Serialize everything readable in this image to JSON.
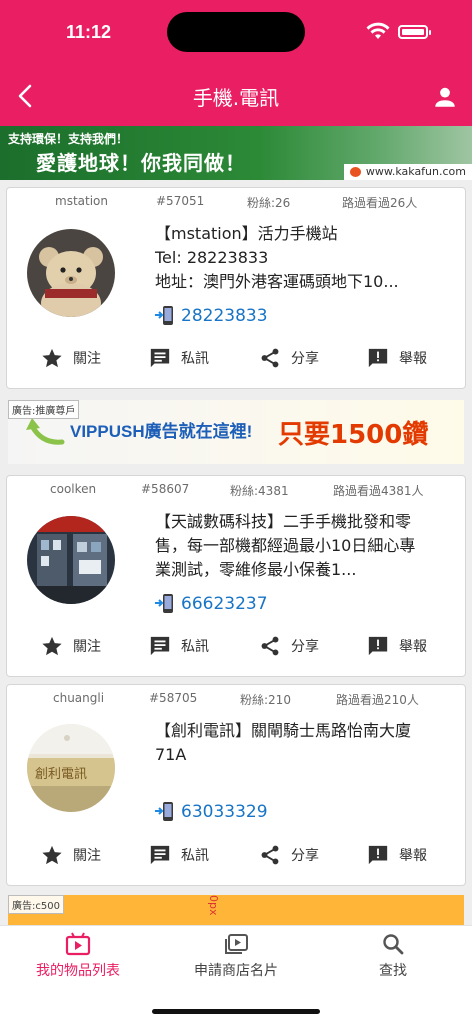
{
  "status": {
    "time": "11:12"
  },
  "header": {
    "title": "手機.電訊"
  },
  "top_banner": {
    "line1": "支持環保！支持我們！",
    "line2": "愛護地球！你我同做！",
    "site": "www.kakafun.com"
  },
  "actions": {
    "follow": "關注",
    "message": "私訊",
    "share": "分享",
    "report": "舉報"
  },
  "cards": [
    {
      "user": "mstation",
      "id": "#57051",
      "fans": "粉絲:26",
      "views": "路過看過26人",
      "lines": [
        "【mstation】活力手機站",
        "Tel: 28223833",
        "地址：澳門外港客運碼頭地下10..."
      ],
      "phone": "28223833"
    },
    {
      "user": "coolken",
      "id": "#58607",
      "fans": "粉絲:4381",
      "views": "路過看過4381人",
      "desc": "【天誠數碼科技】二手手機批發和零售，每一部機都經過最小10日細心專業測試，零維修最小保養1...",
      "phone": "66623237"
    },
    {
      "user": "chuangli",
      "id": "#58705",
      "fans": "粉絲:210",
      "views": "路過看過210人",
      "desc": "【創利電訊】關閘騎士馬路怡南大廈71A",
      "phone": "63033329"
    }
  ],
  "ad_mid": {
    "tag": "廣告:推廣尊戶",
    "text": "VIPPUSH廣告就在這裡!",
    "price": "只要1500鑽"
  },
  "ad_bottom": {
    "tag": "廣告:c500",
    "side": "0px"
  },
  "bottom_nav": {
    "items": [
      "我的物品列表",
      "申請商店名片",
      "查找"
    ]
  },
  "colors": {
    "primary": "#e91e63",
    "link": "#1874c6"
  }
}
